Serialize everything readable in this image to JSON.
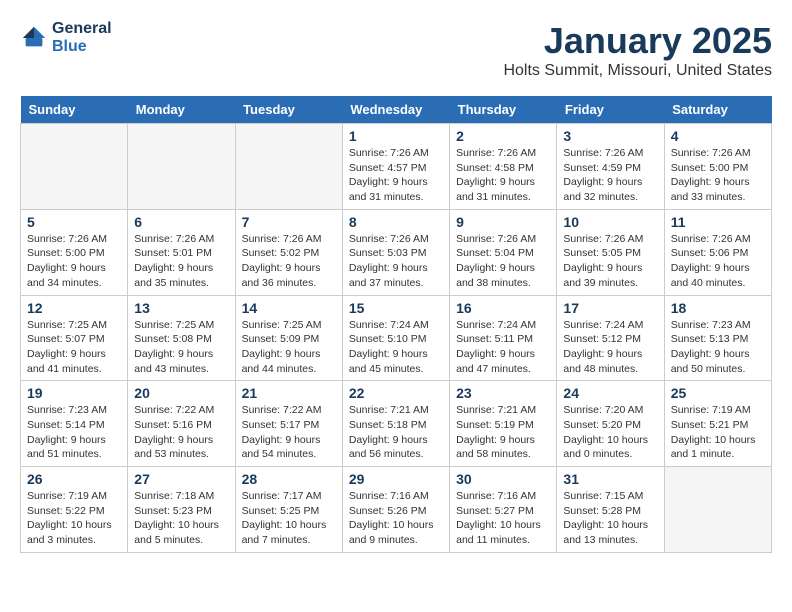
{
  "header": {
    "logo_line1": "General",
    "logo_line2": "Blue",
    "title": "January 2025",
    "subtitle": "Holts Summit, Missouri, United States"
  },
  "days_of_week": [
    "Sunday",
    "Monday",
    "Tuesday",
    "Wednesday",
    "Thursday",
    "Friday",
    "Saturday"
  ],
  "weeks": [
    [
      {
        "day": "",
        "info": ""
      },
      {
        "day": "",
        "info": ""
      },
      {
        "day": "",
        "info": ""
      },
      {
        "day": "1",
        "info": "Sunrise: 7:26 AM\nSunset: 4:57 PM\nDaylight: 9 hours\nand 31 minutes."
      },
      {
        "day": "2",
        "info": "Sunrise: 7:26 AM\nSunset: 4:58 PM\nDaylight: 9 hours\nand 31 minutes."
      },
      {
        "day": "3",
        "info": "Sunrise: 7:26 AM\nSunset: 4:59 PM\nDaylight: 9 hours\nand 32 minutes."
      },
      {
        "day": "4",
        "info": "Sunrise: 7:26 AM\nSunset: 5:00 PM\nDaylight: 9 hours\nand 33 minutes."
      }
    ],
    [
      {
        "day": "5",
        "info": "Sunrise: 7:26 AM\nSunset: 5:00 PM\nDaylight: 9 hours\nand 34 minutes."
      },
      {
        "day": "6",
        "info": "Sunrise: 7:26 AM\nSunset: 5:01 PM\nDaylight: 9 hours\nand 35 minutes."
      },
      {
        "day": "7",
        "info": "Sunrise: 7:26 AM\nSunset: 5:02 PM\nDaylight: 9 hours\nand 36 minutes."
      },
      {
        "day": "8",
        "info": "Sunrise: 7:26 AM\nSunset: 5:03 PM\nDaylight: 9 hours\nand 37 minutes."
      },
      {
        "day": "9",
        "info": "Sunrise: 7:26 AM\nSunset: 5:04 PM\nDaylight: 9 hours\nand 38 minutes."
      },
      {
        "day": "10",
        "info": "Sunrise: 7:26 AM\nSunset: 5:05 PM\nDaylight: 9 hours\nand 39 minutes."
      },
      {
        "day": "11",
        "info": "Sunrise: 7:26 AM\nSunset: 5:06 PM\nDaylight: 9 hours\nand 40 minutes."
      }
    ],
    [
      {
        "day": "12",
        "info": "Sunrise: 7:25 AM\nSunset: 5:07 PM\nDaylight: 9 hours\nand 41 minutes."
      },
      {
        "day": "13",
        "info": "Sunrise: 7:25 AM\nSunset: 5:08 PM\nDaylight: 9 hours\nand 43 minutes."
      },
      {
        "day": "14",
        "info": "Sunrise: 7:25 AM\nSunset: 5:09 PM\nDaylight: 9 hours\nand 44 minutes."
      },
      {
        "day": "15",
        "info": "Sunrise: 7:24 AM\nSunset: 5:10 PM\nDaylight: 9 hours\nand 45 minutes."
      },
      {
        "day": "16",
        "info": "Sunrise: 7:24 AM\nSunset: 5:11 PM\nDaylight: 9 hours\nand 47 minutes."
      },
      {
        "day": "17",
        "info": "Sunrise: 7:24 AM\nSunset: 5:12 PM\nDaylight: 9 hours\nand 48 minutes."
      },
      {
        "day": "18",
        "info": "Sunrise: 7:23 AM\nSunset: 5:13 PM\nDaylight: 9 hours\nand 50 minutes."
      }
    ],
    [
      {
        "day": "19",
        "info": "Sunrise: 7:23 AM\nSunset: 5:14 PM\nDaylight: 9 hours\nand 51 minutes."
      },
      {
        "day": "20",
        "info": "Sunrise: 7:22 AM\nSunset: 5:16 PM\nDaylight: 9 hours\nand 53 minutes."
      },
      {
        "day": "21",
        "info": "Sunrise: 7:22 AM\nSunset: 5:17 PM\nDaylight: 9 hours\nand 54 minutes."
      },
      {
        "day": "22",
        "info": "Sunrise: 7:21 AM\nSunset: 5:18 PM\nDaylight: 9 hours\nand 56 minutes."
      },
      {
        "day": "23",
        "info": "Sunrise: 7:21 AM\nSunset: 5:19 PM\nDaylight: 9 hours\nand 58 minutes."
      },
      {
        "day": "24",
        "info": "Sunrise: 7:20 AM\nSunset: 5:20 PM\nDaylight: 10 hours\nand 0 minutes."
      },
      {
        "day": "25",
        "info": "Sunrise: 7:19 AM\nSunset: 5:21 PM\nDaylight: 10 hours\nand 1 minute."
      }
    ],
    [
      {
        "day": "26",
        "info": "Sunrise: 7:19 AM\nSunset: 5:22 PM\nDaylight: 10 hours\nand 3 minutes."
      },
      {
        "day": "27",
        "info": "Sunrise: 7:18 AM\nSunset: 5:23 PM\nDaylight: 10 hours\nand 5 minutes."
      },
      {
        "day": "28",
        "info": "Sunrise: 7:17 AM\nSunset: 5:25 PM\nDaylight: 10 hours\nand 7 minutes."
      },
      {
        "day": "29",
        "info": "Sunrise: 7:16 AM\nSunset: 5:26 PM\nDaylight: 10 hours\nand 9 minutes."
      },
      {
        "day": "30",
        "info": "Sunrise: 7:16 AM\nSunset: 5:27 PM\nDaylight: 10 hours\nand 11 minutes."
      },
      {
        "day": "31",
        "info": "Sunrise: 7:15 AM\nSunset: 5:28 PM\nDaylight: 10 hours\nand 13 minutes."
      },
      {
        "day": "",
        "info": ""
      }
    ]
  ]
}
